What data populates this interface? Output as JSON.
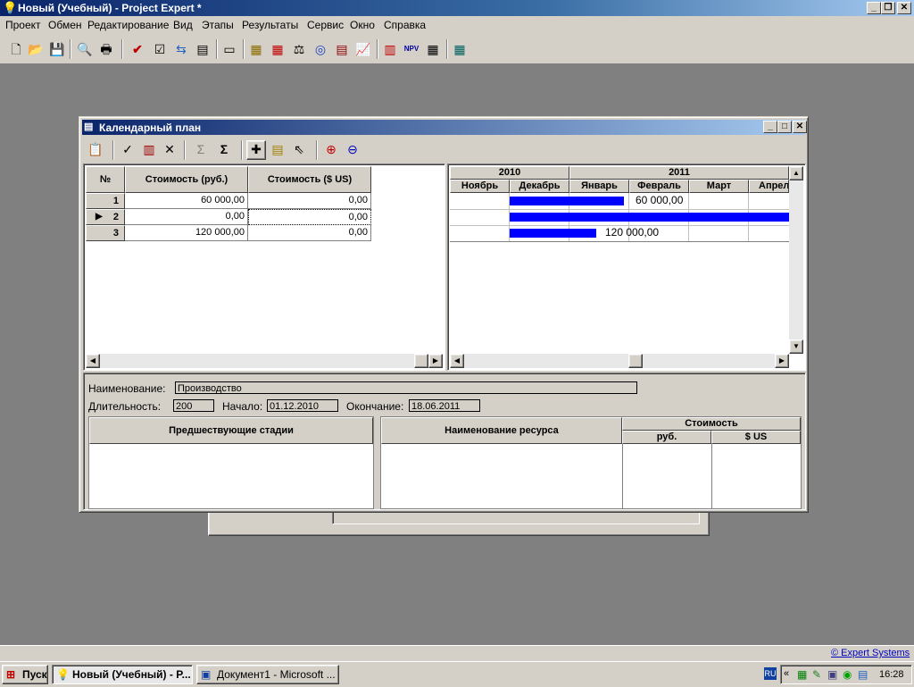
{
  "app": {
    "title": "Новый (Учебный) - Project Expert *"
  },
  "menu": [
    "Проект",
    "Обмен",
    "Редактирование",
    "Вид",
    "Этапы",
    "Результаты",
    "Сервис",
    "Окно",
    "Справка"
  ],
  "window": {
    "title": "Календарный план"
  },
  "table": {
    "headers": [
      "№",
      "Стоимость (руб.)",
      "Стоимость ($ US)"
    ],
    "rows": [
      {
        "num": "1",
        "rub": "60 000,00",
        "usd": "0,00"
      },
      {
        "num": "2",
        "rub": "0,00",
        "usd": "0,00"
      },
      {
        "num": "3",
        "rub": "120 000,00",
        "usd": "0,00"
      }
    ]
  },
  "gantt": {
    "years": [
      "2010",
      "2011"
    ],
    "months": [
      "Ноябрь",
      "Декабрь",
      "Январь",
      "Февраль",
      "Март",
      "Апрел"
    ],
    "bar_labels": [
      "60 000,00",
      "120 000,00"
    ],
    "bar_color": "#0000ff"
  },
  "details": {
    "name_label": "Наименование:",
    "name_value": "Производство",
    "duration_label": "Длительность:",
    "duration_value": "200",
    "start_label": "Начало:",
    "start_value": "01.12.2010",
    "end_label": "Окончание:",
    "end_value": "18.06.2011",
    "prev_stages": "Предшествующие стадии",
    "resource_name": "Наименование ресурса",
    "cost": "Стоимость",
    "rub": "руб.",
    "usd": "$ US"
  },
  "status": {
    "link": "© Expert Systems"
  },
  "taskbar": {
    "start": "Пуск",
    "tasks": [
      "Новый (Учебный) - P...",
      "Документ1 - Microsoft ..."
    ],
    "lang": "RU",
    "time": "16:28"
  }
}
